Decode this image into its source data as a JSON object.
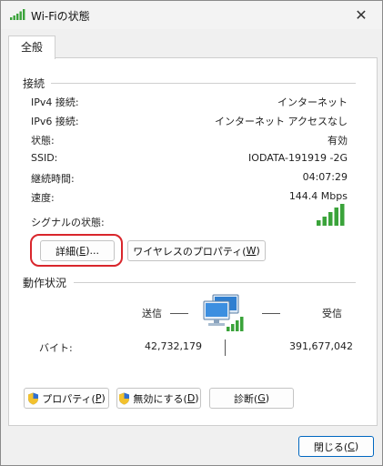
{
  "window": {
    "title": "Wi-Fiの状態"
  },
  "tabs": [
    {
      "label": "全般"
    }
  ],
  "connection": {
    "header": "接続",
    "rows": [
      {
        "label": "IPv4 接続:",
        "value": "インターネット"
      },
      {
        "label": "IPv6 接続:",
        "value": "インターネット アクセスなし"
      },
      {
        "label": "状態:",
        "value": "有効"
      },
      {
        "label": "SSID:",
        "value": "IODATA-191919 -2G"
      },
      {
        "label": "継続時間:",
        "value": "04:07:29"
      },
      {
        "label": "速度:",
        "value": "144.4 Mbps"
      }
    ],
    "signal_label": "シグナルの状態:",
    "signal_strength": 5,
    "details_button": {
      "label": "詳細(",
      "key": "E",
      "suffix": ")..."
    },
    "wireless_props_button": {
      "label": "ワイヤレスのプロパティ(",
      "key": "W",
      "suffix": ")"
    }
  },
  "activity": {
    "header": "動作状況",
    "sent_label": "送信",
    "received_label": "受信",
    "bytes_label": "バイト:",
    "sent_bytes": "42,732,179",
    "received_bytes": "391,677,042"
  },
  "buttons": {
    "properties": {
      "label": "プロパティ(",
      "key": "P",
      "suffix": ")"
    },
    "disable": {
      "label": "無効にする(",
      "key": "D",
      "suffix": ")"
    },
    "diagnose": {
      "label": "診断(",
      "key": "G",
      "suffix": ")"
    },
    "close": {
      "label": "閉じる(",
      "key": "C",
      "suffix": ")"
    }
  },
  "colors": {
    "signal": "#3aa33a",
    "highlight": "#d9262c",
    "monitor": "#2f7fd0"
  }
}
